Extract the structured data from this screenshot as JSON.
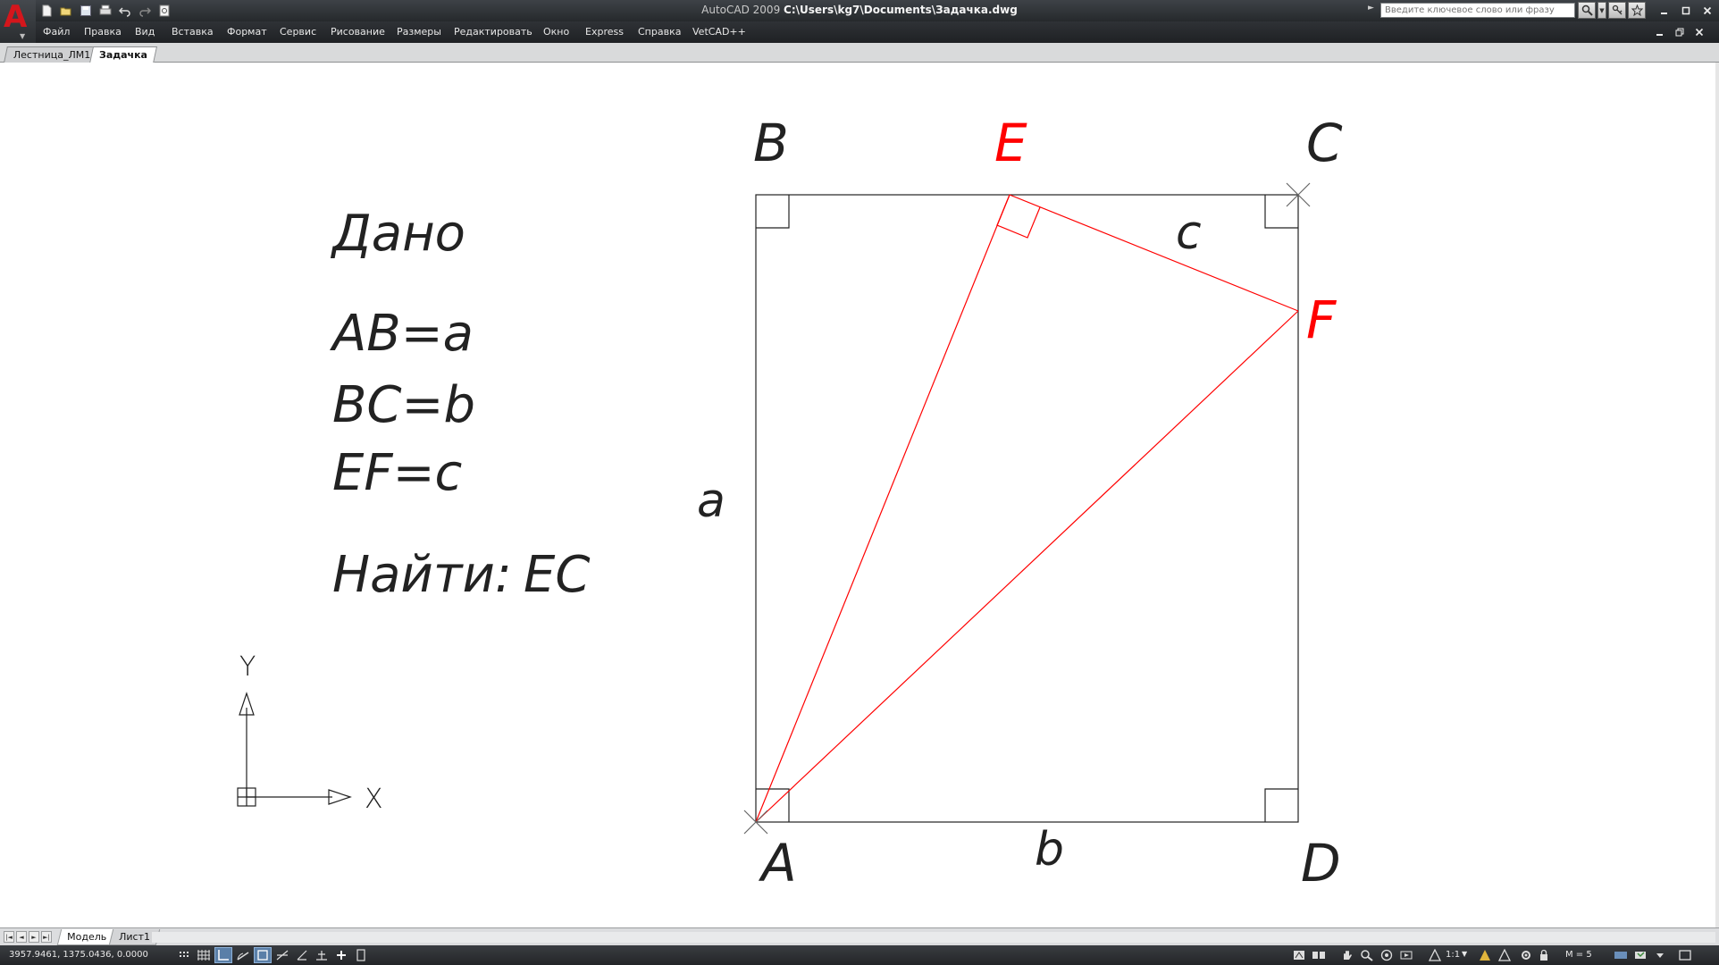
{
  "window": {
    "app_name": "AutoCAD 2009",
    "file_path": "C:\\Users\\kg7\\Documents\\Задачка.dwg"
  },
  "quick_access": [
    {
      "name": "new-icon"
    },
    {
      "name": "open-icon"
    },
    {
      "name": "save-icon"
    },
    {
      "name": "plot-icon"
    },
    {
      "name": "undo-icon"
    },
    {
      "name": "redo-icon"
    },
    {
      "name": "plot-preview-icon"
    }
  ],
  "infocenter": {
    "search_placeholder": "Введите ключевое слово или фразу"
  },
  "menu": [
    "Файл",
    "Правка",
    "Вид",
    "Вставка",
    "Формат",
    "Сервис",
    "Рисование",
    "Размеры",
    "Редактировать",
    "Окно",
    "Express",
    "Справка",
    "VetCAD++"
  ],
  "tabs": [
    {
      "label": "Лестница_ЛМ1",
      "active": false
    },
    {
      "label": "Задачка",
      "active": true
    }
  ],
  "drawing": {
    "colors": {
      "black": "#222222",
      "red": "#ff0000",
      "grey": "#666666"
    },
    "given_title": "Дано",
    "given_lines": [
      "AB=a",
      "BC=b",
      "EF=c"
    ],
    "find_label": "Найти:",
    "find_value": "EC",
    "points": {
      "A": "A",
      "B": "B",
      "C": "C",
      "D": "D",
      "E": "E",
      "F": "F"
    },
    "side_labels": {
      "a": "a",
      "b": "b",
      "c": "c"
    },
    "ucs": {
      "x": "X",
      "y": "Y"
    }
  },
  "layout_tabs": [
    {
      "label": "Модель",
      "active": true
    },
    {
      "label": "Лист1",
      "active": false
    }
  ],
  "status": {
    "coordinates": "3957.9461, 1375.0436, 0.0000",
    "scale": "1:1",
    "m_value": "M = 5"
  }
}
